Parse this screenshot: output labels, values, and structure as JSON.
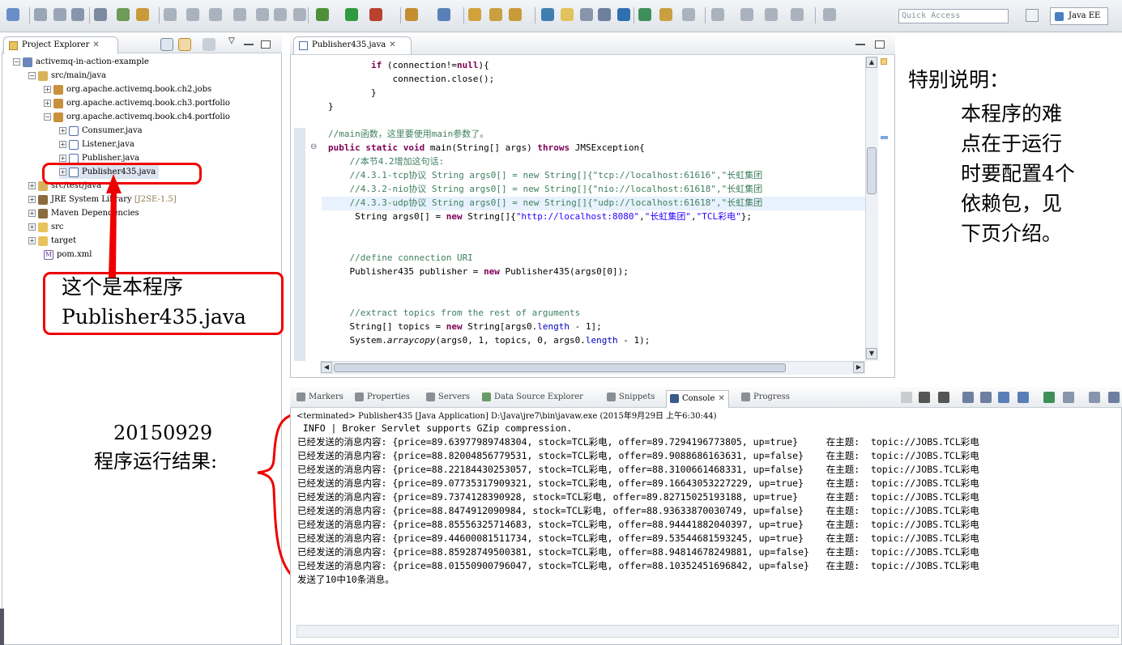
{
  "toolbar": {
    "quick_access": "Quick Access",
    "perspective": "Java EE"
  },
  "explorer": {
    "tab": "Project Explorer",
    "items": [
      {
        "label": "activemq-in-action-example",
        "suffix": ""
      },
      {
        "label": "src/main/java",
        "suffix": ""
      },
      {
        "label": "org.apache.activemq.book.ch2.jobs",
        "suffix": ""
      },
      {
        "label": "org.apache.activemq.book.ch3.portfolio",
        "suffix": ""
      },
      {
        "label": "org.apache.activemq.book.ch4.portfolio",
        "suffix": ""
      },
      {
        "label": "Consumer.java",
        "suffix": ""
      },
      {
        "label": "Listener.java",
        "suffix": ""
      },
      {
        "label": "Publisher.java",
        "suffix": ""
      },
      {
        "label": "Publisher435.java",
        "suffix": ""
      },
      {
        "label": "src/test/java",
        "suffix": ""
      },
      {
        "label": "JRE System Library",
        "suffix": "[J2SE-1.5]"
      },
      {
        "label": "Maven Dependencies",
        "suffix": ""
      },
      {
        "label": "src",
        "suffix": ""
      },
      {
        "label": "target",
        "suffix": ""
      },
      {
        "label": "pom.xml",
        "suffix": ""
      }
    ]
  },
  "editor": {
    "tab": "Publisher435.java",
    "lines": [
      {
        "p": [
          {
            "t": "        ",
            "c": ""
          },
          {
            "t": "if",
            "c": "kw"
          },
          {
            "t": " (connection!=",
            "c": ""
          },
          {
            "t": "null",
            "c": "kw"
          },
          {
            "t": "){",
            "c": ""
          }
        ]
      },
      {
        "p": [
          {
            "t": "            connection.close();",
            "c": ""
          }
        ]
      },
      {
        "p": [
          {
            "t": "        }",
            "c": ""
          }
        ]
      },
      {
        "p": [
          {
            "t": "}",
            "c": ""
          }
        ]
      },
      {
        "p": [
          {
            "t": "",
            "c": ""
          }
        ]
      },
      {
        "p": [
          {
            "t": "//main函数，这里要使用main参数了。",
            "c": "cm"
          }
        ]
      },
      {
        "p": [
          {
            "t": "public",
            "c": "kw"
          },
          {
            "t": " ",
            "c": ""
          },
          {
            "t": "static",
            "c": "kw"
          },
          {
            "t": " ",
            "c": ""
          },
          {
            "t": "void",
            "c": "kw"
          },
          {
            "t": " main(String[] args) ",
            "c": ""
          },
          {
            "t": "throws",
            "c": "kw"
          },
          {
            "t": " JMSException{",
            "c": ""
          }
        ]
      },
      {
        "p": [
          {
            "t": "    //本节4.2增加这句话:",
            "c": "cm"
          }
        ]
      },
      {
        "p": [
          {
            "t": "    //4.3.1-tcp协议 String args0[] = new String[]{\"tcp://localhost:61616\",\"长虹集团",
            "c": "cm"
          }
        ]
      },
      {
        "p": [
          {
            "t": "    //4.3.2-nio协议 String args0[] = new String[]{\"nio://localhost:61618\",\"长虹集团",
            "c": "cm"
          }
        ]
      },
      {
        "p": [
          {
            "t": "    //4.3.3-udp协议 String args0[] = new String[]{\"udp://localhost:61618\",\"长虹集团",
            "c": "cm"
          }
        ]
      },
      {
        "p": [
          {
            "t": "     String args0[] = ",
            "c": ""
          },
          {
            "t": "new",
            "c": "kw"
          },
          {
            "t": " String[]{",
            "c": ""
          },
          {
            "t": "\"http://localhost:8080\"",
            "c": "st"
          },
          {
            "t": ",",
            "c": ""
          },
          {
            "t": "\"长虹集团\"",
            "c": "st"
          },
          {
            "t": ",",
            "c": ""
          },
          {
            "t": "\"TCL彩电\"",
            "c": "st"
          },
          {
            "t": "};",
            "c": ""
          }
        ]
      },
      {
        "p": [
          {
            "t": "",
            "c": ""
          }
        ]
      },
      {
        "p": [
          {
            "t": "",
            "c": ""
          }
        ]
      },
      {
        "p": [
          {
            "t": "    //define connection URI",
            "c": "cm"
          }
        ]
      },
      {
        "p": [
          {
            "t": "    Publisher435 publisher = ",
            "c": ""
          },
          {
            "t": "new",
            "c": "kw"
          },
          {
            "t": " Publisher435(args0[0]);",
            "c": ""
          }
        ]
      },
      {
        "p": [
          {
            "t": "",
            "c": ""
          }
        ]
      },
      {
        "p": [
          {
            "t": "",
            "c": ""
          }
        ]
      },
      {
        "p": [
          {
            "t": "    //extract topics from the rest of arguments",
            "c": "cm"
          }
        ]
      },
      {
        "p": [
          {
            "t": "    String[] topics = ",
            "c": ""
          },
          {
            "t": "new",
            "c": "kw"
          },
          {
            "t": " String[args0.",
            "c": ""
          },
          {
            "t": "length",
            "c": "fld"
          },
          {
            "t": " - 1];",
            "c": ""
          }
        ]
      },
      {
        "p": [
          {
            "t": "    System.",
            "c": ""
          },
          {
            "t": "arraycopy",
            "c": "it"
          },
          {
            "t": "(args0, 1, topics, 0, args0.",
            "c": ""
          },
          {
            "t": "length",
            "c": "fld"
          },
          {
            "t": " - 1);",
            "c": ""
          }
        ]
      }
    ]
  },
  "note": {
    "title": "特别说明：",
    "body_lines": [
      "本程序的难",
      "点在于运行",
      "时要配置4个",
      "依赖包，见",
      "下页介绍。"
    ]
  },
  "annotation_program": {
    "line1": "这个是本程序",
    "line2": "Publisher435.java"
  },
  "annotation_result": {
    "line1": "20150929",
    "line2": "程序运行结果:"
  },
  "console": {
    "tabs": [
      "Markers",
      "Properties",
      "Servers",
      "Data Source Explorer",
      "Snippets",
      "Console",
      "Progress"
    ],
    "terminated": "<terminated> Publisher435 [Java Application] D:\\Java\\jre7\\bin\\javaw.exe (2015年9月29日 上午6:30:44)",
    "lines": [
      " INFO | Broker Servlet supports GZip compression.",
      "已经发送的消息内容: {price=89.63977989748304, stock=TCL彩电, offer=89.7294196773805, up=true}     在主题:  topic://JOBS.TCL彩电",
      "已经发送的消息内容: {price=88.82004856779531, stock=TCL彩电, offer=89.9088686163631, up=false}    在主题:  topic://JOBS.TCL彩电",
      "已经发送的消息内容: {price=88.22184430253057, stock=TCL彩电, offer=88.3100661468331, up=false}    在主题:  topic://JOBS.TCL彩电",
      "已经发送的消息内容: {price=89.07735317909321, stock=TCL彩电, offer=89.16643053227229, up=true}    在主题:  topic://JOBS.TCL彩电",
      "已经发送的消息内容: {price=89.7374128390928, stock=TCL彩电, offer=89.82715025193188, up=true}     在主题:  topic://JOBS.TCL彩电",
      "已经发送的消息内容: {price=88.8474912090984, stock=TCL彩电, offer=88.93633870030749, up=false}    在主题:  topic://JOBS.TCL彩电",
      "已经发送的消息内容: {price=88.85556325714683, stock=TCL彩电, offer=88.94441882040397, up=true}    在主题:  topic://JOBS.TCL彩电",
      "已经发送的消息内容: {price=89.44600081511734, stock=TCL彩电, offer=89.53544681593245, up=true}    在主题:  topic://JOBS.TCL彩电",
      "已经发送的消息内容: {price=88.85928749500381, stock=TCL彩电, offer=88.94814678249881, up=false}   在主题:  topic://JOBS.TCL彩电",
      "已经发送的消息内容: {price=88.01550900796047, stock=TCL彩电, offer=88.10352451696842, up=false}   在主题:  topic://JOBS.TCL彩电",
      "发送了10中10条消息。"
    ]
  }
}
